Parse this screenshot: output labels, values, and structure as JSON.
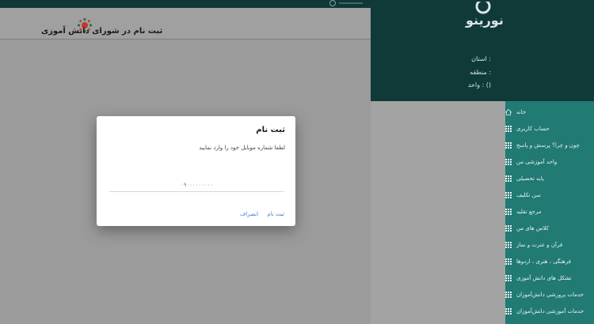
{
  "page": {
    "title": "ثبت نام در شورای دانش آموزی"
  },
  "sidebar": {
    "brand": "نورينو",
    "info": [
      {
        "label": ": استان"
      },
      {
        "label": ": منطقه"
      },
      {
        "label": "() : واحد"
      }
    ],
    "menu": [
      {
        "label": "خانه",
        "icon": "home-icon"
      },
      {
        "label": "حساب کاربری",
        "icon": "grid-icon"
      },
      {
        "label": "چون و چرا؟ پرسش و پاسخ",
        "icon": "grid-icon"
      },
      {
        "label": "واحد آموزشی من",
        "icon": "grid-icon"
      },
      {
        "label": "پایه تحصیلی",
        "icon": "grid-icon"
      },
      {
        "label": "سن تکلیف",
        "icon": "grid-icon"
      },
      {
        "label": "مرجع تقلید",
        "icon": "grid-icon"
      },
      {
        "label": "کلاس های من",
        "icon": "grid-icon"
      },
      {
        "label": "قرآن و عترت و نماز",
        "icon": "grid-icon"
      },
      {
        "label": "فرهنگی ، هنری ، اردوها",
        "icon": "grid-icon"
      },
      {
        "label": "تشکل های دانش آموزی",
        "icon": "grid-icon"
      },
      {
        "label": "خدمات پرورشی دانش‌آموزان",
        "icon": "grid-icon"
      },
      {
        "label": "خدمات آموزشی دانش‌آموزان",
        "icon": "grid-icon"
      }
    ]
  },
  "modal": {
    "title": "ثبت نام",
    "message": "لطفا شماره موبایل خود را وارد نمایید",
    "input_value": "",
    "input_placeholder": "۰۹۰۰۰۰۰۰۰۰۰",
    "register_label": "ثبت نام",
    "cancel_label": "انصراف"
  },
  "colors": {
    "sidebar_dark": "#0f3a38",
    "menu_teal": "#217a74",
    "link_blue": "#3f7fdc",
    "overlay_gray": "#9b9b9b"
  }
}
